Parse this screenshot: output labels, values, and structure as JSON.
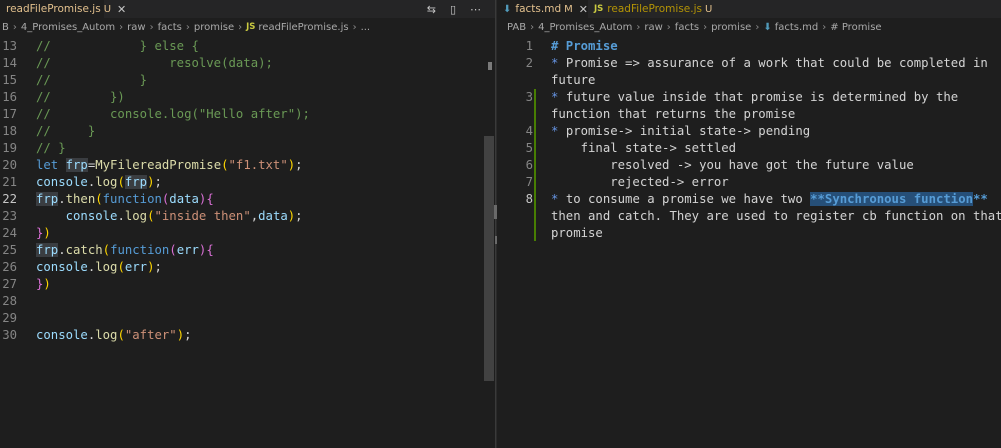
{
  "left": {
    "tab": {
      "name": "readFilePromise.js",
      "status": "U",
      "close": "✕"
    },
    "actions": {
      "compare": "⇆",
      "split": "▯",
      "more": "⋯"
    },
    "breadcrumb": [
      "B",
      "4_Promises_Autom",
      "raw",
      "facts",
      "promise",
      "readFilePromise.js",
      "..."
    ],
    "lines": [
      {
        "n": "13",
        "segs": [
          [
            "cm",
            "//            } else {"
          ]
        ]
      },
      {
        "n": "14",
        "segs": [
          [
            "cm",
            "//                resolve(data);"
          ]
        ]
      },
      {
        "n": "15",
        "segs": [
          [
            "cm",
            "//            }"
          ]
        ]
      },
      {
        "n": "16",
        "segs": [
          [
            "cm",
            "//        })"
          ]
        ]
      },
      {
        "n": "17",
        "segs": [
          [
            "cm",
            "//        console.log(\"Hello after\");"
          ]
        ]
      },
      {
        "n": "18",
        "segs": [
          [
            "cm",
            "//     }"
          ]
        ]
      },
      {
        "n": "19",
        "segs": [
          [
            "cm",
            "// }"
          ]
        ]
      },
      {
        "n": "20",
        "segs": [
          [
            "kw",
            "let "
          ],
          [
            "var hl",
            "frp"
          ],
          [
            "plain",
            "="
          ],
          [
            "fn",
            "MyFilereadPromise"
          ],
          [
            "br1",
            "("
          ],
          [
            "str",
            "\"f1.txt\""
          ],
          [
            "br1",
            ")"
          ],
          [
            "plain",
            ";"
          ]
        ]
      },
      {
        "n": "21",
        "segs": [
          [
            "var",
            "console"
          ],
          [
            "plain",
            "."
          ],
          [
            "fn",
            "log"
          ],
          [
            "br1",
            "("
          ],
          [
            "var hl",
            "frp"
          ],
          [
            "br1",
            ")"
          ],
          [
            "plain",
            ";"
          ]
        ]
      },
      {
        "n": "22",
        "active": true,
        "segs": [
          [
            "var hl",
            "frp"
          ],
          [
            "plain",
            "."
          ],
          [
            "fn",
            "then"
          ],
          [
            "br1",
            "("
          ],
          [
            "kw",
            "function"
          ],
          [
            "br2",
            "("
          ],
          [
            "var",
            "data"
          ],
          [
            "br2",
            ")"
          ],
          [
            "br2",
            "{"
          ]
        ]
      },
      {
        "n": "23",
        "segs": [
          [
            "plain",
            "    "
          ],
          [
            "var",
            "console"
          ],
          [
            "plain",
            "."
          ],
          [
            "fn",
            "log"
          ],
          [
            "br1",
            "("
          ],
          [
            "str",
            "\"inside then\""
          ],
          [
            "plain",
            ","
          ],
          [
            "var",
            "data"
          ],
          [
            "br1",
            ")"
          ],
          [
            "plain",
            ";"
          ]
        ]
      },
      {
        "n": "24",
        "segs": [
          [
            "br2",
            "}"
          ],
          [
            "br1",
            ")"
          ]
        ]
      },
      {
        "n": "25",
        "segs": [
          [
            "var hl",
            "frp"
          ],
          [
            "plain",
            "."
          ],
          [
            "fn",
            "catch"
          ],
          [
            "br1",
            "("
          ],
          [
            "kw",
            "function"
          ],
          [
            "br2",
            "("
          ],
          [
            "var",
            "err"
          ],
          [
            "br2",
            ")"
          ],
          [
            "br2",
            "{"
          ]
        ]
      },
      {
        "n": "26",
        "segs": [
          [
            "var",
            "console"
          ],
          [
            "plain",
            "."
          ],
          [
            "fn",
            "log"
          ],
          [
            "br1",
            "("
          ],
          [
            "var",
            "err"
          ],
          [
            "br1",
            ")"
          ],
          [
            "plain",
            ";"
          ]
        ]
      },
      {
        "n": "27",
        "segs": [
          [
            "br2",
            "}"
          ],
          [
            "br1",
            ")"
          ]
        ]
      },
      {
        "n": "28",
        "segs": []
      },
      {
        "n": "29",
        "segs": []
      },
      {
        "n": "30",
        "segs": [
          [
            "var",
            "console"
          ],
          [
            "plain",
            "."
          ],
          [
            "fn",
            "log"
          ],
          [
            "br1",
            "("
          ],
          [
            "str",
            "\"after\""
          ],
          [
            "br1",
            ")"
          ],
          [
            "plain",
            ";"
          ]
        ]
      }
    ]
  },
  "right": {
    "tabs": [
      {
        "name": "facts.md",
        "status": "M",
        "close": "✕",
        "icon": "md",
        "active": true
      },
      {
        "name": "readFilePromise.js",
        "status": "U",
        "icon": "js",
        "active": false
      }
    ],
    "breadcrumb": [
      "PAB",
      "4_Promises_Autom",
      "raw",
      "facts",
      "promise",
      "facts.md",
      "# Promise"
    ],
    "lines": [
      {
        "n": "1",
        "segs": [
          [
            "md-h",
            "# Promise"
          ]
        ]
      },
      {
        "n": "2",
        "segs": [
          [
            "md-b",
            "* "
          ],
          [
            "plain",
            "Promise => assurance of a work that could be completed in"
          ]
        ]
      },
      {
        "n": "",
        "segs": [
          [
            "plain",
            "future"
          ]
        ]
      },
      {
        "n": "3",
        "segs": [
          [
            "md-b",
            "* "
          ],
          [
            "plain",
            "future value inside that promise is determined by the"
          ]
        ]
      },
      {
        "n": "",
        "segs": [
          [
            "plain",
            "function that returns the promise"
          ]
        ]
      },
      {
        "n": "4",
        "segs": [
          [
            "md-b",
            "* "
          ],
          [
            "plain",
            "promise-> initial state-> pending"
          ]
        ]
      },
      {
        "n": "5",
        "segs": [
          [
            "plain",
            "    final state-> settled"
          ]
        ]
      },
      {
        "n": "6",
        "segs": [
          [
            "plain",
            "        resolved -> you have got the future value"
          ]
        ]
      },
      {
        "n": "7",
        "segs": [
          [
            "plain",
            "        rejected-> error"
          ]
        ]
      },
      {
        "n": "8",
        "active": true,
        "segs": [
          [
            "md-b",
            "* "
          ],
          [
            "plain",
            "to consume a promise we have two "
          ],
          [
            "md-bold sel",
            "**Synchronous function"
          ],
          [
            "md-bold",
            "**"
          ]
        ]
      },
      {
        "n": "",
        "segs": [
          [
            "plain",
            "then and catch. They are used to register cb function on that"
          ]
        ]
      },
      {
        "n": "",
        "segs": [
          [
            "plain",
            "promise"
          ]
        ]
      }
    ]
  }
}
